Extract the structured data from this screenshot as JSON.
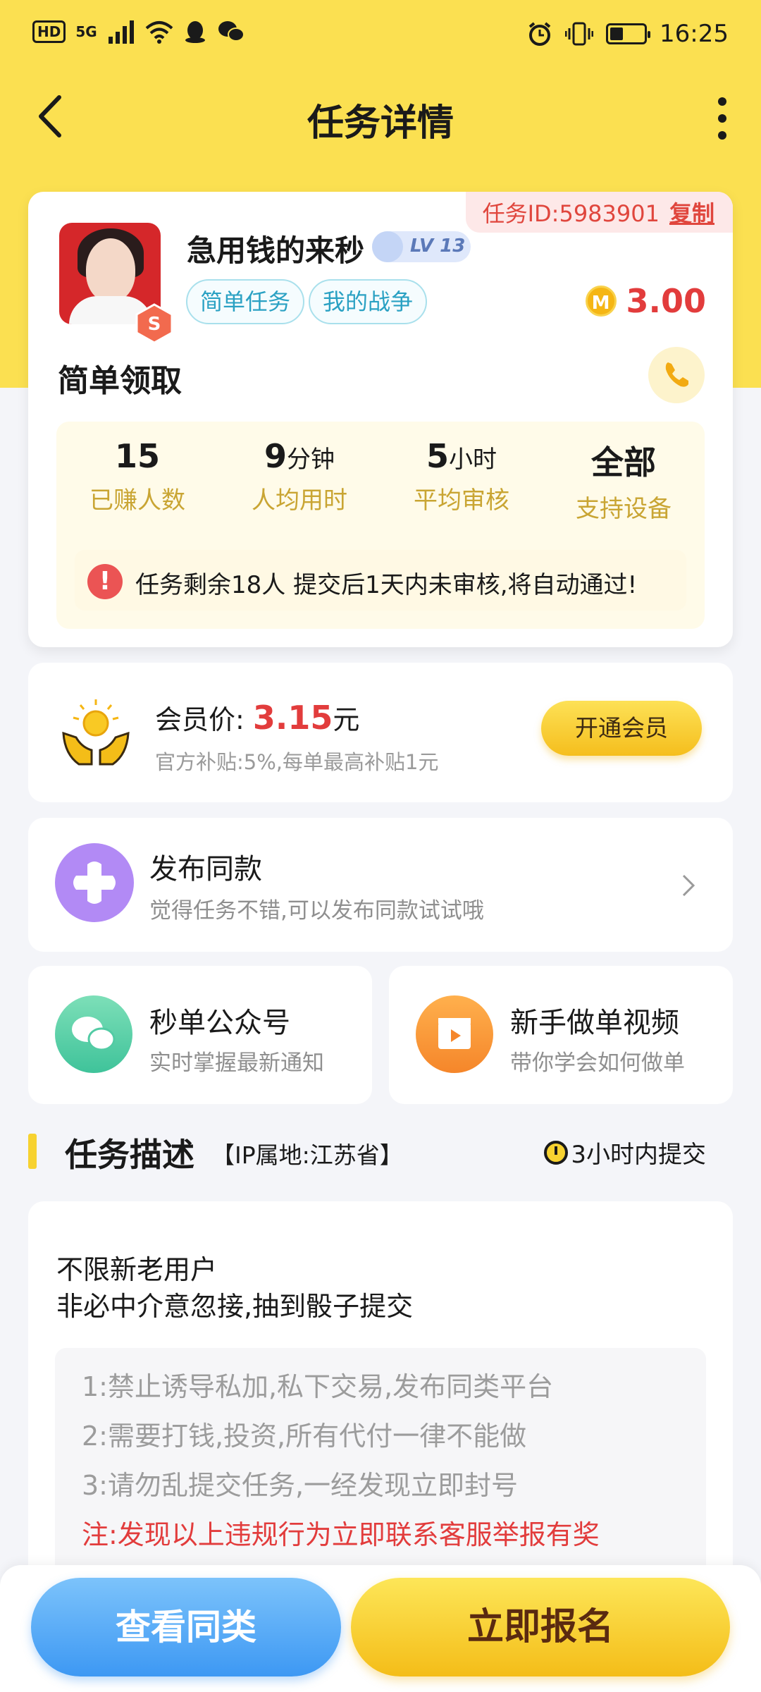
{
  "status_bar": {
    "hd": "HD",
    "network": "5G",
    "time": "16:25",
    "battery_level": 0.35,
    "icons": [
      "signal-icon",
      "wifi-icon",
      "qq-icon",
      "wechat-icon",
      "alarm-icon",
      "vibrate-icon",
      "battery-icon"
    ]
  },
  "nav": {
    "title": "任务详情",
    "icons": [
      "back-arrow-icon",
      "more-vertical-icon"
    ]
  },
  "task_card": {
    "task_id_label": "任务ID:5983901",
    "copy_label": "复制",
    "username": "急用钱的来秒",
    "level": "LV 13",
    "tags": [
      "简单任务",
      "我的战争"
    ],
    "reward": "3.00",
    "coin_symbol": "M",
    "title": "简单领取",
    "stats": [
      {
        "value": "15",
        "unit": "",
        "label": "已赚人数"
      },
      {
        "value": "9",
        "unit": "分钟",
        "label": "人均用时"
      },
      {
        "value": "5",
        "unit": "小时",
        "label": "平均审核"
      },
      {
        "value": "全部",
        "unit": "",
        "label": "支持设备"
      }
    ],
    "notice": "任务剩余18人  提交后1天内未审核,将自动通过!"
  },
  "member": {
    "label": "会员价:",
    "price": "3.15",
    "unit": "元",
    "subsidy": "官方补贴:5%,每单最高补贴1元",
    "button": "开通会员"
  },
  "publish": {
    "title": "发布同款",
    "subtitle": "觉得任务不错,可以发布同款试试哦"
  },
  "shortcuts": [
    {
      "title": "秒单公众号",
      "subtitle": "实时掌握最新通知"
    },
    {
      "title": "新手做单视频",
      "subtitle": "带你学会如何做单"
    }
  ],
  "description": {
    "title": "任务描述",
    "ip": "【IP属地:江苏省】",
    "time_limit": "3小时内提交",
    "lines": [
      "不限新老用户",
      "非必中介意忽接,抽到骰子提交"
    ],
    "rules": [
      "1:禁止诱导私加,私下交易,发布同类平台",
      "2:需要打钱,投资,所有代付一律不能做",
      "3:请勿乱提交任务,一经发现立即封号"
    ],
    "warning": "注:发现以上违规行为立即联系客服举报有奖"
  },
  "bottom": {
    "similar_button": "查看同类",
    "apply_button": "立即报名"
  },
  "colors": {
    "header_yellow": "#fbe051",
    "price_red": "#e23c3c",
    "button_blue": "#3d98f3",
    "button_yellow": "#f4bd18"
  }
}
